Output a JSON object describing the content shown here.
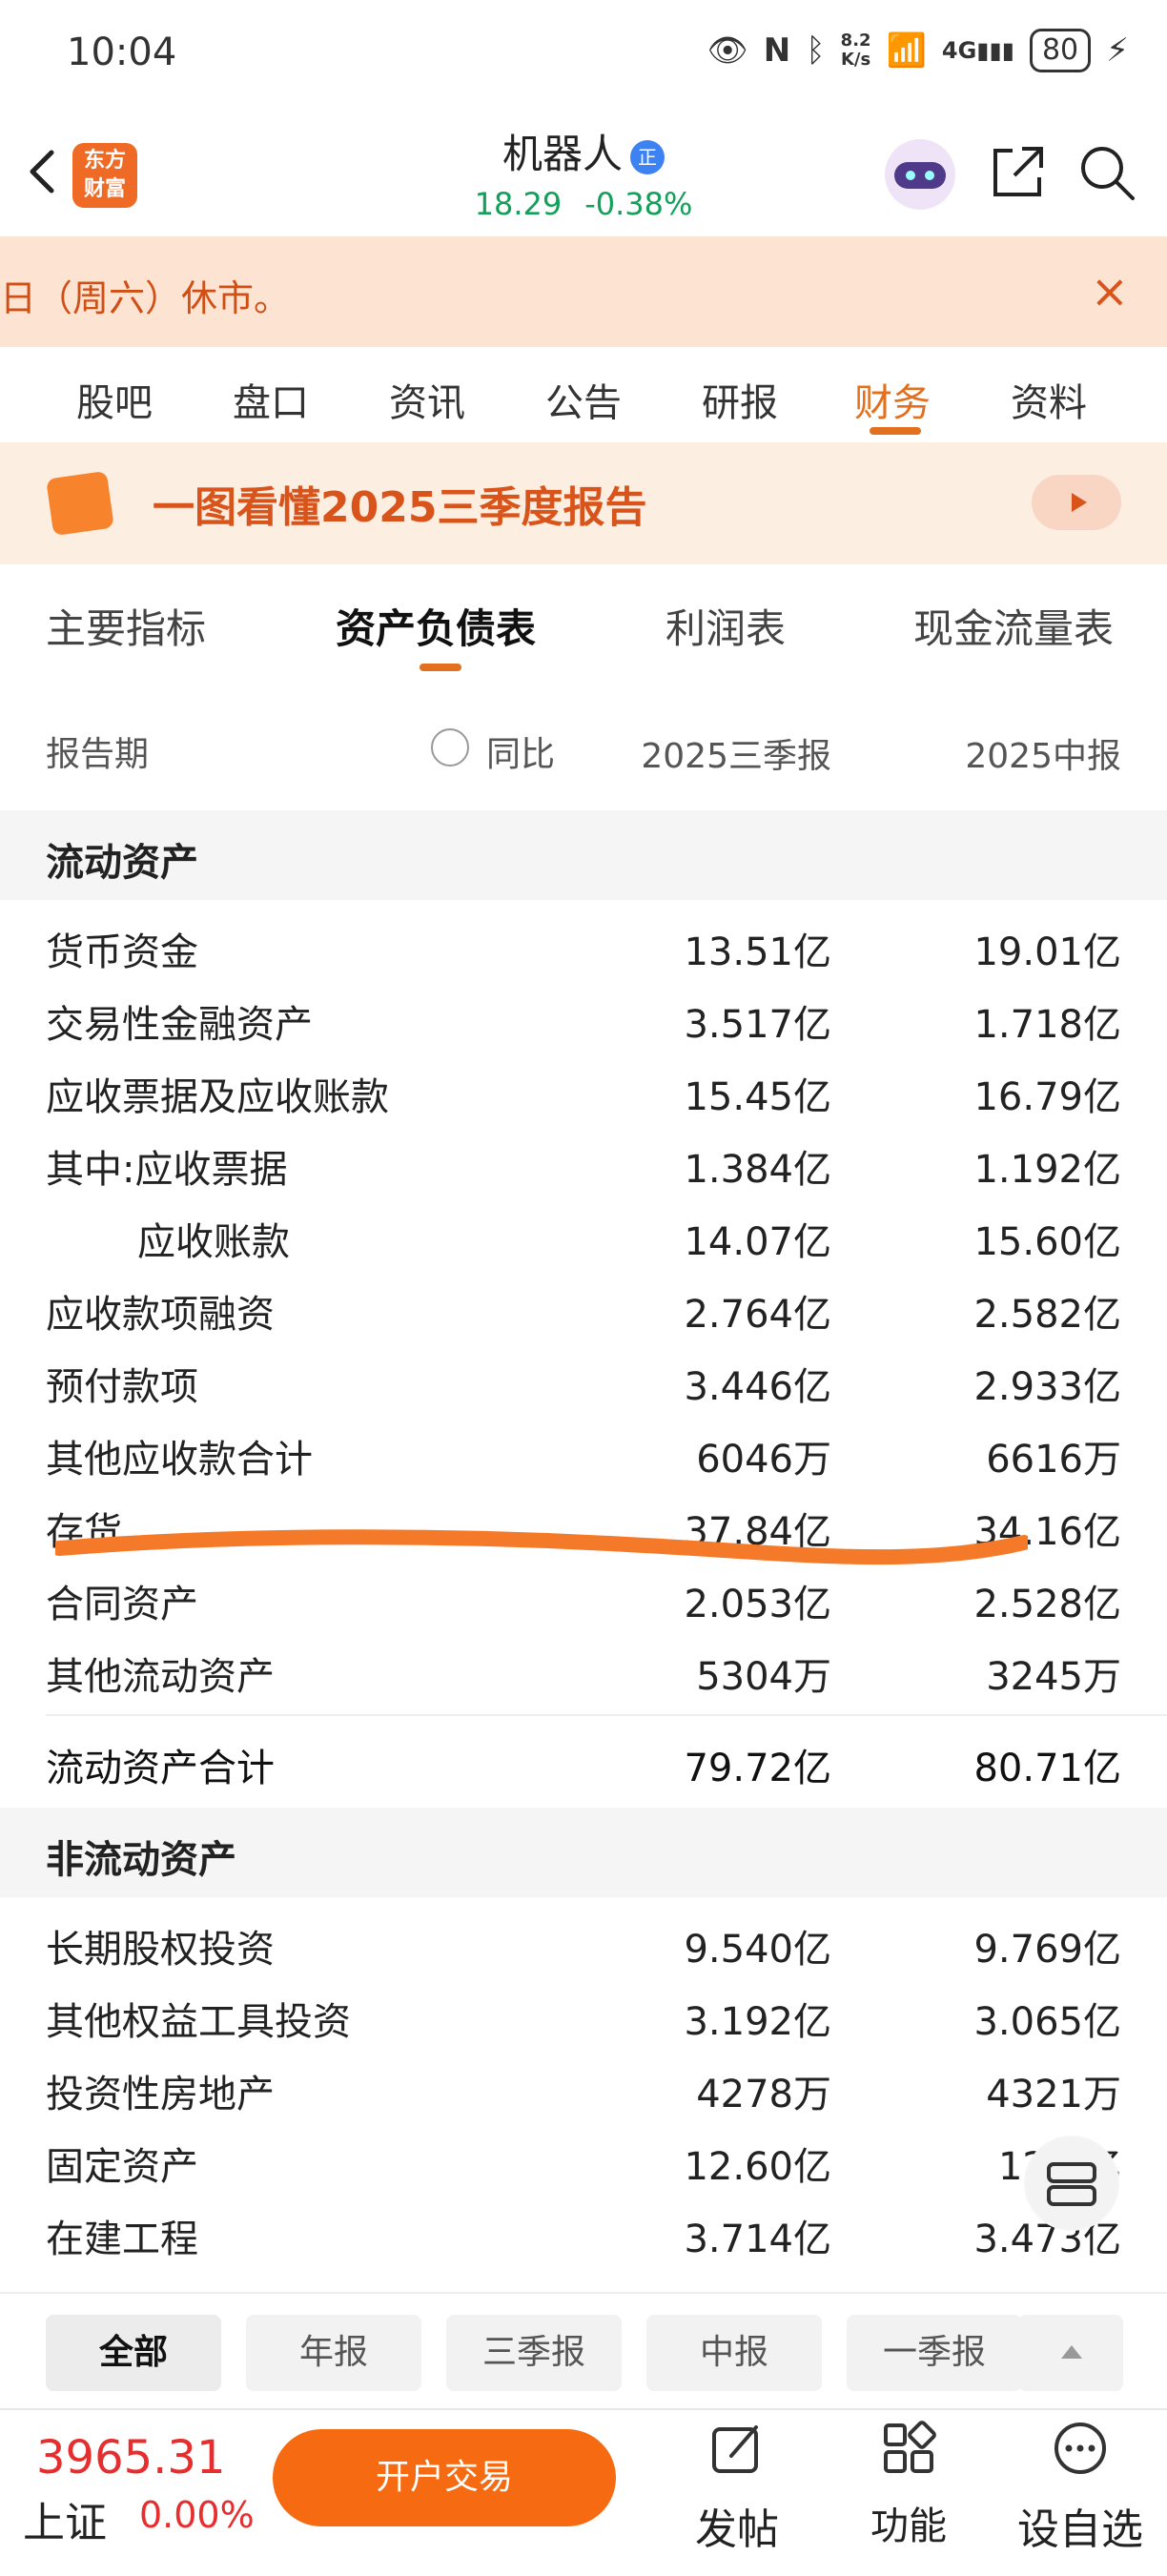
{
  "status_bar": {
    "time": "10:04",
    "net_speed_top": "8.2",
    "net_speed_bottom": "K/s",
    "battery": "80"
  },
  "header": {
    "back_icon": "back-arrow-icon",
    "app_logo_line1": "东方",
    "app_logo_line2": "财富",
    "stock_name": "机器人",
    "badge": "正",
    "price": "18.29",
    "change": "-0.38%",
    "price_color": "#13a05a"
  },
  "notice": {
    "text": "日（周六）休市。",
    "close": "×"
  },
  "main_tabs": [
    {
      "label": "股吧"
    },
    {
      "label": "盘口"
    },
    {
      "label": "资讯"
    },
    {
      "label": "公告"
    },
    {
      "label": "研报"
    },
    {
      "label": "财务",
      "active": true
    },
    {
      "label": "资料"
    }
  ],
  "banner": {
    "text": "一图看懂2025三季度报告"
  },
  "sub_tabs": [
    {
      "label": "主要指标"
    },
    {
      "label": "资产负债表",
      "active": true
    },
    {
      "label": "利润表"
    },
    {
      "label": "现金流量表"
    }
  ],
  "columns": {
    "period_label": "报告期",
    "yoy_label": "同比",
    "col1": "2025三季报",
    "col2": "2025中报"
  },
  "sections": [
    {
      "title": "流动资产"
    },
    {
      "title": "非流动资产"
    }
  ],
  "current_assets": [
    {
      "name": "货币资金",
      "v1": "13.51亿",
      "v2": "19.01亿"
    },
    {
      "name": "交易性金融资产",
      "v1": "3.517亿",
      "v2": "1.718亿"
    },
    {
      "name": "应收票据及应收账款",
      "v1": "15.45亿",
      "v2": "16.79亿"
    },
    {
      "name": "其中:应收票据",
      "v1": "1.384亿",
      "v2": "1.192亿"
    },
    {
      "name": "应收账款",
      "v1": "14.07亿",
      "v2": "15.60亿"
    },
    {
      "name": "应收款项融资",
      "v1": "2.764亿",
      "v2": "2.582亿"
    },
    {
      "name": "预付款项",
      "v1": "3.446亿",
      "v2": "2.933亿"
    },
    {
      "name": "其他应收款合计",
      "v1": "6046万",
      "v2": "6616万"
    },
    {
      "name": "存货",
      "v1": "37.84亿",
      "v2": "34.16亿"
    },
    {
      "name": "合同资产",
      "v1": "2.053亿",
      "v2": "2.528亿"
    },
    {
      "name": "其他流动资产",
      "v1": "5304万",
      "v2": "3245万"
    }
  ],
  "current_total": {
    "name": "流动资产合计",
    "v1": "79.72亿",
    "v2": "80.71亿"
  },
  "noncurrent_assets": [
    {
      "name": "长期股权投资",
      "v1": "9.540亿",
      "v2": "9.769亿"
    },
    {
      "name": "其他权益工具投资",
      "v1": "3.192亿",
      "v2": "3.065亿"
    },
    {
      "name": "投资性房地产",
      "v1": "4278万",
      "v2": "4321万"
    },
    {
      "name": "固定资产",
      "v1": "12.60亿",
      "v2": "12.6亿"
    },
    {
      "name": "在建工程",
      "v1": "3.714亿",
      "v2": "3.473亿"
    }
  ],
  "period_filters": [
    {
      "label": "全部",
      "active": true
    },
    {
      "label": "年报"
    },
    {
      "label": "三季报"
    },
    {
      "label": "中报"
    },
    {
      "label": "一季报"
    }
  ],
  "bottom_bar": {
    "index_value": "3965.31",
    "index_name": "上证",
    "index_pct": "0.00%",
    "trade_label": "开户交易",
    "post_label": "发帖",
    "func_label": "功能",
    "watch_label": "设自选"
  },
  "accent_color": "#e3701e"
}
